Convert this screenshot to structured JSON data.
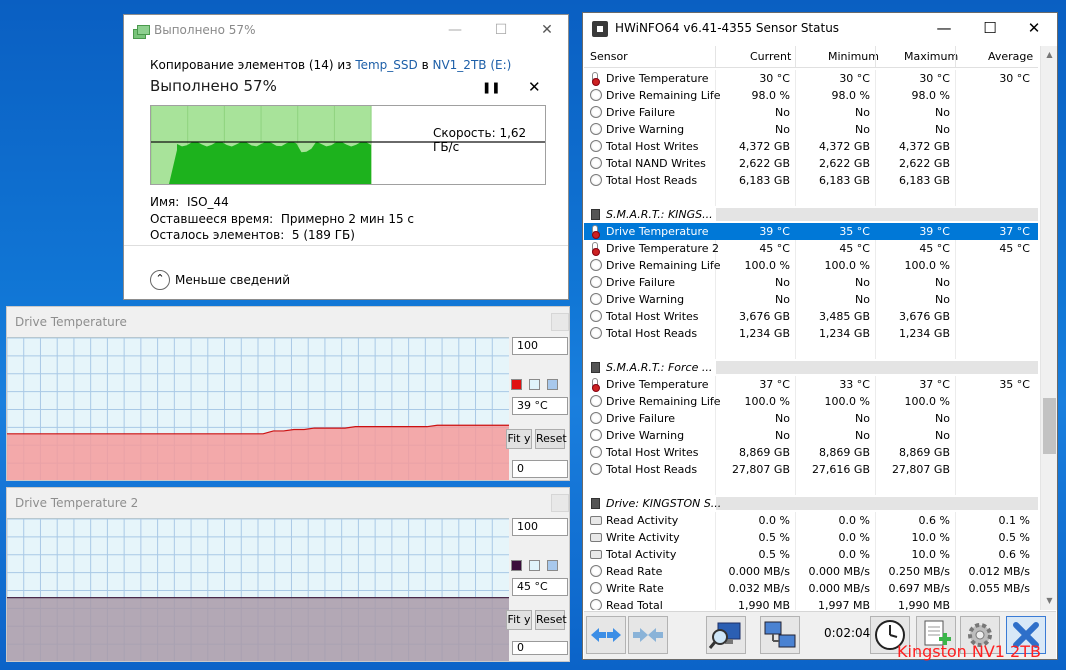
{
  "copy_dialog": {
    "title": "Выполнено 57%",
    "desc_prefix": "Копирование элементов (14) из ",
    "source": "Temp_SSD",
    "desc_mid": " в ",
    "destination": "NV1_2TB (E:)",
    "status": "Выполнено 57%",
    "progress_percent": 57,
    "speed": "Скорость: 1,62 ГБ/с",
    "name_label": "Имя:",
    "name_value": "ISO_44",
    "time_label": "Оставшееся время:",
    "time_value": "Примерно 2 мин 15 с",
    "items_label": "Осталось элементов:",
    "items_value": "5 (189 ГБ)",
    "fewer_details": "Меньше сведений",
    "colors": {
      "fill_bg": "#a8e39a",
      "fill_curve": "#1db21d"
    }
  },
  "graphs": [
    {
      "title": "Drive Temperature",
      "max": "100",
      "current": "39 °C",
      "min": "0",
      "fit_label": "Fit y",
      "reset_label": "Reset",
      "fill_color": "#f49b9b",
      "line_color": "#cc1111",
      "series": [
        33,
        33,
        33,
        33,
        33,
        33,
        33,
        33,
        33,
        33,
        33,
        33,
        33,
        33,
        33,
        33,
        33,
        33,
        33,
        33,
        33,
        33,
        33,
        33,
        33,
        33,
        35,
        35,
        36,
        36,
        37,
        37,
        37,
        37,
        38,
        38,
        38,
        38,
        38,
        38,
        38,
        38,
        39,
        39,
        39,
        39,
        39,
        39,
        39,
        39
      ]
    },
    {
      "title": "Drive Temperature 2",
      "max": "100",
      "current": "45 °C",
      "min": "0",
      "fit_label": "Fit y",
      "reset_label": "Reset",
      "fill_color": "#a99aa8",
      "line_color": "#4a2a4a",
      "series": [
        45,
        45,
        45,
        45,
        45,
        45,
        45,
        45,
        45,
        45,
        45,
        45,
        45,
        45,
        45,
        45,
        45,
        45,
        45,
        45,
        45,
        45,
        45,
        45,
        45,
        45,
        45,
        45,
        45,
        45,
        45,
        45,
        45,
        45,
        45,
        45,
        45,
        45,
        45,
        45,
        45,
        45,
        45,
        45,
        45,
        45,
        45,
        45,
        45,
        45
      ]
    }
  ],
  "hwinfo": {
    "title": "HWiNFO64 v6.41-4355 Sensor Status",
    "columns": [
      "Sensor",
      "Current",
      "Minimum",
      "Maximum",
      "Average"
    ],
    "rows": [
      {
        "icon": "temp",
        "name": "Drive Temperature",
        "v": [
          "30 °C",
          "30 °C",
          "30 °C",
          "30 °C"
        ]
      },
      {
        "icon": "circle",
        "name": "Drive Remaining Life",
        "v": [
          "98.0 %",
          "98.0 %",
          "98.0 %",
          ""
        ]
      },
      {
        "icon": "circle",
        "name": "Drive Failure",
        "v": [
          "No",
          "No",
          "No",
          ""
        ]
      },
      {
        "icon": "circle",
        "name": "Drive Warning",
        "v": [
          "No",
          "No",
          "No",
          ""
        ]
      },
      {
        "icon": "circle",
        "name": "Total Host Writes",
        "v": [
          "4,372 GB",
          "4,372 GB",
          "4,372 GB",
          ""
        ]
      },
      {
        "icon": "circle",
        "name": "Total NAND Writes",
        "v": [
          "2,622 GB",
          "2,622 GB",
          "2,622 GB",
          ""
        ]
      },
      {
        "icon": "circle",
        "name": "Total Host Reads",
        "v": [
          "6,183 GB",
          "6,183 GB",
          "6,183 GB",
          ""
        ]
      },
      {
        "icon": "blank",
        "name": "",
        "v": [
          "",
          "",
          "",
          ""
        ]
      },
      {
        "icon": "group",
        "name": "S.M.A.R.T.: KINGS...",
        "v": [
          "",
          "",
          "",
          ""
        ]
      },
      {
        "icon": "temp",
        "name": "Drive Temperature",
        "v": [
          "39 °C",
          "35 °C",
          "39 °C",
          "37 °C"
        ],
        "selected": true
      },
      {
        "icon": "temp",
        "name": "Drive Temperature 2",
        "v": [
          "45 °C",
          "45 °C",
          "45 °C",
          "45 °C"
        ]
      },
      {
        "icon": "circle",
        "name": "Drive Remaining Life",
        "v": [
          "100.0 %",
          "100.0 %",
          "100.0 %",
          ""
        ]
      },
      {
        "icon": "circle",
        "name": "Drive Failure",
        "v": [
          "No",
          "No",
          "No",
          ""
        ]
      },
      {
        "icon": "circle",
        "name": "Drive Warning",
        "v": [
          "No",
          "No",
          "No",
          ""
        ]
      },
      {
        "icon": "circle",
        "name": "Total Host Writes",
        "v": [
          "3,676 GB",
          "3,485 GB",
          "3,676 GB",
          ""
        ]
      },
      {
        "icon": "circle",
        "name": "Total Host Reads",
        "v": [
          "1,234 GB",
          "1,234 GB",
          "1,234 GB",
          ""
        ]
      },
      {
        "icon": "blank",
        "name": "",
        "v": [
          "",
          "",
          "",
          ""
        ]
      },
      {
        "icon": "group",
        "name": "S.M.A.R.T.: Force ...",
        "v": [
          "",
          "",
          "",
          ""
        ]
      },
      {
        "icon": "temp",
        "name": "Drive Temperature",
        "v": [
          "37 °C",
          "33 °C",
          "37 °C",
          "35 °C"
        ]
      },
      {
        "icon": "circle",
        "name": "Drive Remaining Life",
        "v": [
          "100.0 %",
          "100.0 %",
          "100.0 %",
          ""
        ]
      },
      {
        "icon": "circle",
        "name": "Drive Failure",
        "v": [
          "No",
          "No",
          "No",
          ""
        ]
      },
      {
        "icon": "circle",
        "name": "Drive Warning",
        "v": [
          "No",
          "No",
          "No",
          ""
        ]
      },
      {
        "icon": "circle",
        "name": "Total Host Writes",
        "v": [
          "8,869 GB",
          "8,869 GB",
          "8,869 GB",
          ""
        ]
      },
      {
        "icon": "circle",
        "name": "Total Host Reads",
        "v": [
          "27,807 GB",
          "27,616 GB",
          "27,807 GB",
          ""
        ]
      },
      {
        "icon": "blank",
        "name": "",
        "v": [
          "",
          "",
          "",
          ""
        ]
      },
      {
        "icon": "group",
        "name": "Drive: KINGSTON S...",
        "v": [
          "",
          "",
          "",
          ""
        ]
      },
      {
        "icon": "gauge",
        "name": "Read Activity",
        "v": [
          "0.0 %",
          "0.0 %",
          "0.6 %",
          "0.1 %"
        ]
      },
      {
        "icon": "gauge",
        "name": "Write Activity",
        "v": [
          "0.5 %",
          "0.0 %",
          "10.0 %",
          "0.5 %"
        ]
      },
      {
        "icon": "gauge",
        "name": "Total Activity",
        "v": [
          "0.5 %",
          "0.0 %",
          "10.0 %",
          "0.6 %"
        ]
      },
      {
        "icon": "circle",
        "name": "Read Rate",
        "v": [
          "0.000 MB/s",
          "0.000 MB/s",
          "0.250 MB/s",
          "0.012 MB/s"
        ]
      },
      {
        "icon": "circle",
        "name": "Write Rate",
        "v": [
          "0.032 MB/s",
          "0.000 MB/s",
          "0.697 MB/s",
          "0.055 MB/s"
        ]
      },
      {
        "icon": "circle",
        "name": "Read Total",
        "v": [
          "1,990 MB",
          "1,997 MB",
          "1,990 MB",
          ""
        ]
      }
    ],
    "timer": "0:02:04",
    "toolbar_icons": [
      "arrows-left-right-icon",
      "arrows-compress-icon",
      "monitor-search-icon",
      "network-icon",
      "clock-icon",
      "report-add-icon",
      "settings-gear-icon",
      "close-x-icon"
    ]
  },
  "overlay_label": "Kingston NV1 2TB"
}
